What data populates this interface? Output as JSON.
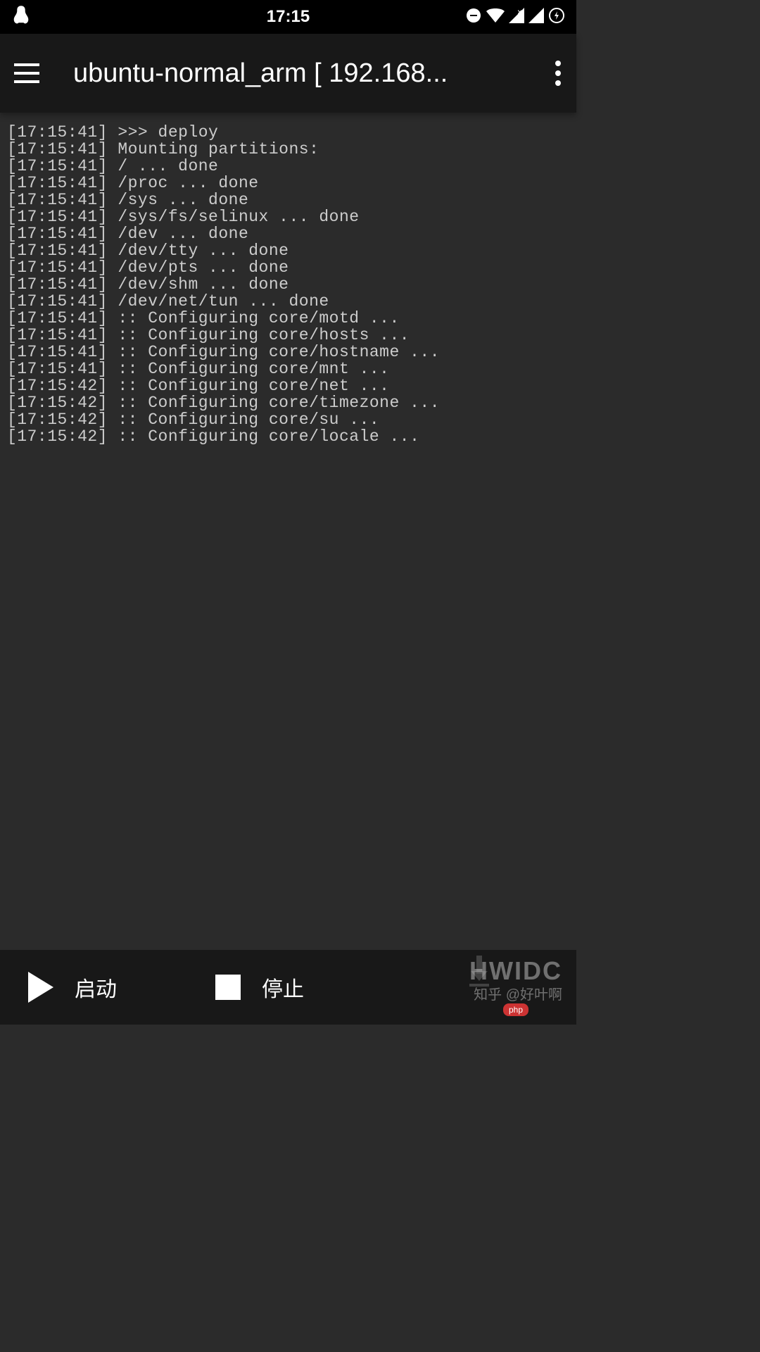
{
  "status_bar": {
    "time": "17:15"
  },
  "app_bar": {
    "title": "ubuntu-normal_arm  [ 192.168..."
  },
  "terminal": {
    "lines": [
      "[17:15:41] >>> deploy",
      "[17:15:41] Mounting partitions:",
      "[17:15:41] / ... done",
      "[17:15:41] /proc ... done",
      "[17:15:41] /sys ... done",
      "[17:15:41] /sys/fs/selinux ... done",
      "[17:15:41] /dev ... done",
      "[17:15:41] /dev/tty ... done",
      "[17:15:41] /dev/pts ... done",
      "[17:15:41] /dev/shm ... done",
      "[17:15:41] /dev/net/tun ... done",
      "[17:15:41] :: Configuring core/motd ...",
      "[17:15:41] :: Configuring core/hosts ...",
      "[17:15:41] :: Configuring core/hostname ...",
      "[17:15:41] :: Configuring core/mnt ...",
      "[17:15:42] :: Configuring core/net ...",
      "[17:15:42] :: Configuring core/timezone ...",
      "[17:15:42] :: Configuring core/su ...",
      "[17:15:42] :: Configuring core/locale ..."
    ]
  },
  "bottom_bar": {
    "start_label": "启动",
    "stop_label": "停止"
  },
  "watermark": {
    "top": "HWIDC",
    "bottom": "知乎 @好叶啊",
    "badge": "php"
  }
}
